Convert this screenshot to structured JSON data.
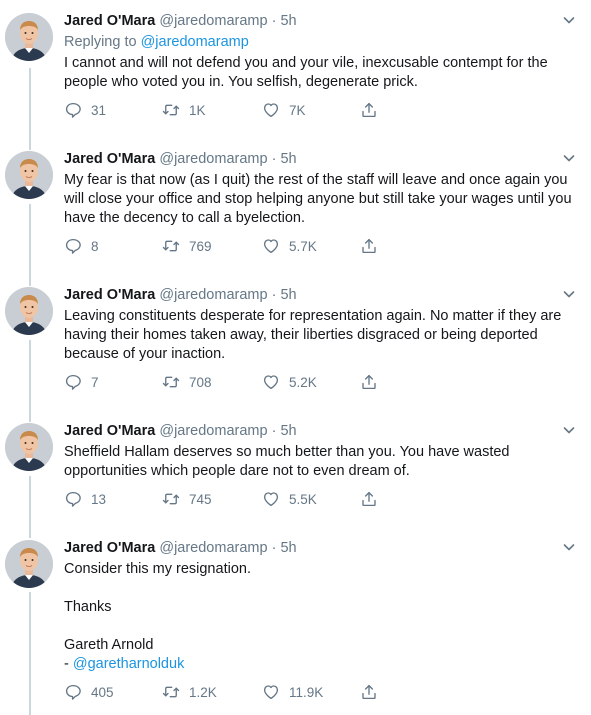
{
  "tweets": [
    {
      "name": "Jared O'Mara",
      "handle": "@jaredomaramp",
      "time": "5h",
      "replying_prefix": "Replying to",
      "replying_to": "@jaredomaramp",
      "text": "I cannot and will not defend you and your vile, inexcusable contempt for the people who voted you in. You selfish, degenerate prick.",
      "replies": "31",
      "retweets": "1K",
      "likes": "7K"
    },
    {
      "name": "Jared O'Mara",
      "handle": "@jaredomaramp",
      "time": "5h",
      "text": "My fear is that now (as I quit) the rest of the staff will leave and once again you will close your office and stop helping anyone but still take your wages until you have the decency to call a byelection.",
      "replies": "8",
      "retweets": "769",
      "likes": "5.7K"
    },
    {
      "name": "Jared O'Mara",
      "handle": "@jaredomaramp",
      "time": "5h",
      "text": "Leaving constituents desperate for representation again. No matter if they are having their homes taken away, their liberties disgraced or being deported because of your inaction.",
      "replies": "7",
      "retweets": "708",
      "likes": "5.2K"
    },
    {
      "name": "Jared O'Mara",
      "handle": "@jaredomaramp",
      "time": "5h",
      "text": "Sheffield Hallam deserves so much better than you. You have wasted opportunities which people dare not to even dream of.",
      "replies": "13",
      "retweets": "745",
      "likes": "5.5K"
    },
    {
      "name": "Jared O'Mara",
      "handle": "@jaredomaramp",
      "time": "5h",
      "text_line1": "Consider this my resignation.",
      "text_line2": "Thanks",
      "text_line3": "Gareth Arnold",
      "text_sig_prefix": "- ",
      "text_sig_link": "@garetharnolduk",
      "replies": "405",
      "retweets": "1.2K",
      "likes": "11.9K"
    }
  ],
  "separator": "·",
  "colors": {
    "text": "#14171a",
    "muted": "#657786",
    "link": "#1b95e0",
    "thread_line": "#ccd6dd"
  },
  "icons": {
    "reply": "reply-icon",
    "retweet": "retweet-icon",
    "like": "heart-icon",
    "share": "share-icon",
    "caret": "chevron-down-icon"
  }
}
